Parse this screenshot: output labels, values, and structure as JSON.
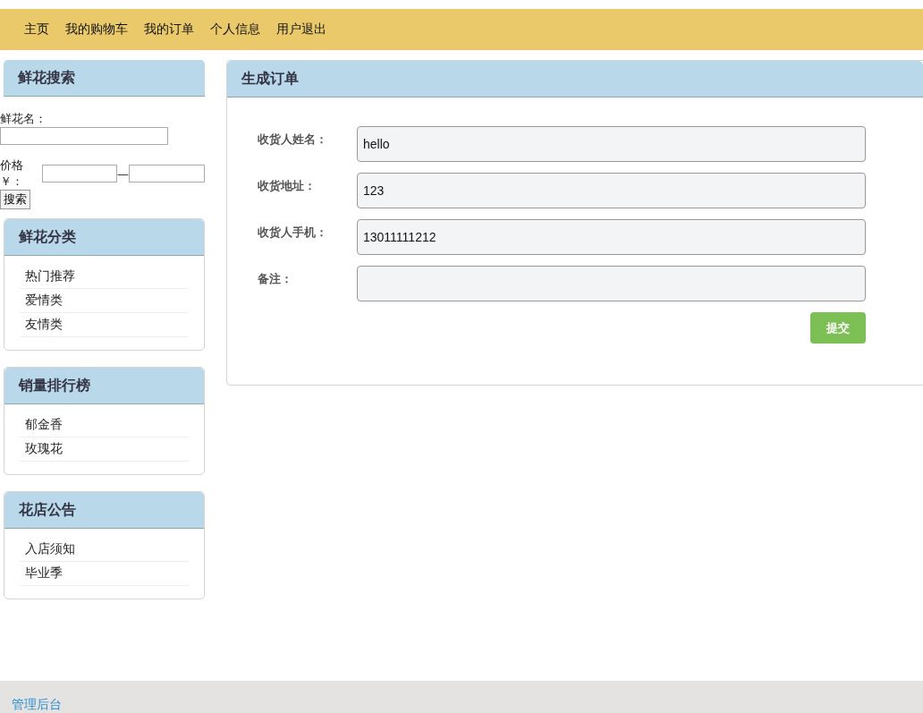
{
  "nav": {
    "items": [
      "主页",
      "我的购物车",
      "我的订单",
      "个人信息",
      "用户退出"
    ]
  },
  "search_panel": {
    "title": "鲜花搜索",
    "name_label": "鲜花名：",
    "price_label": "价格￥：",
    "price_separator": "—",
    "button": "搜索"
  },
  "side_panels": [
    {
      "title": "鲜花分类",
      "items": [
        "热门推荐",
        "爱情类",
        "友情类"
      ]
    },
    {
      "title": "销量排行榜",
      "items": [
        "郁金香",
        "玫瑰花"
      ]
    },
    {
      "title": "花店公告",
      "items": [
        "入店须知",
        "毕业季"
      ]
    }
  ],
  "order_panel": {
    "title": "生成订单",
    "fields": [
      {
        "label": "收货人姓名：",
        "value": "hello"
      },
      {
        "label": "收货地址：",
        "value": "123"
      },
      {
        "label": "收货人手机：",
        "value": "13011111212"
      },
      {
        "label": "备注："
      }
    ],
    "submit": "提交"
  },
  "footer": {
    "link": "管理后台"
  }
}
